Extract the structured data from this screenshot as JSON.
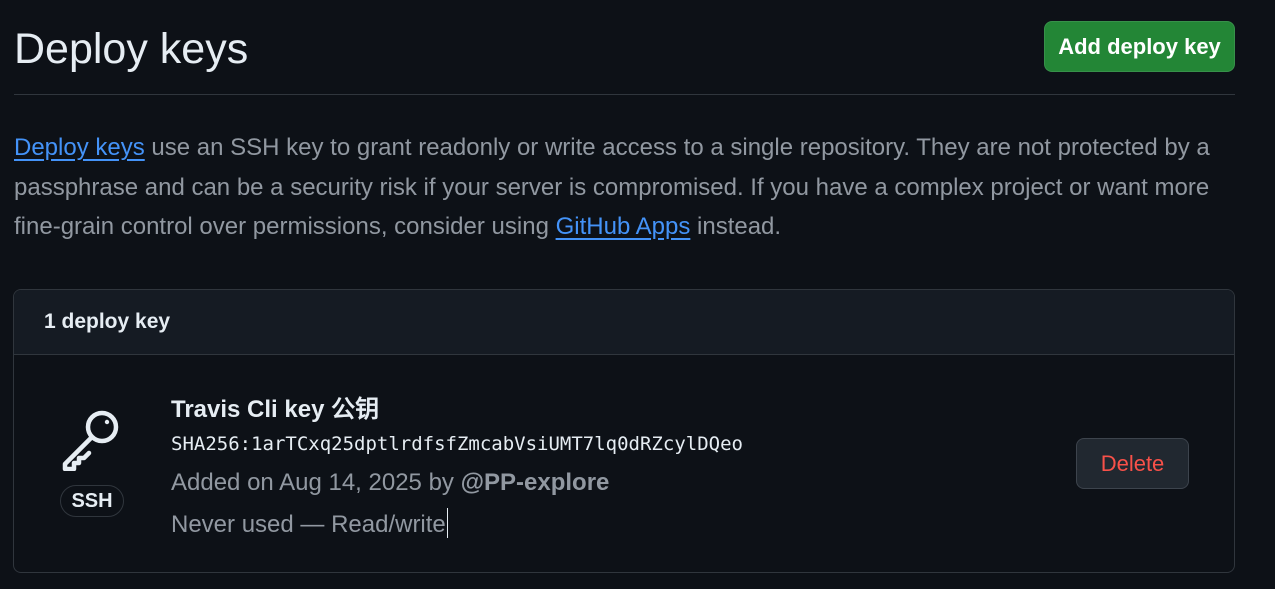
{
  "header": {
    "title": "Deploy keys",
    "add_button_label": "Add deploy key"
  },
  "description": {
    "link1_text": "Deploy keys",
    "text1": " use an SSH key to grant readonly or write access to a single repository. They are not protected by a passphrase and can be a security risk if your server is compromised. If you have a complex project or want more fine-grain control over permissions, consider using ",
    "link2_text": "GitHub Apps",
    "text2": " instead."
  },
  "keys_box": {
    "count_label": "1 deploy key",
    "keys": [
      {
        "icon": "key-icon",
        "type_label": "SSH",
        "title": "Travis Cli key 公钥",
        "fingerprint": "SHA256:1arTCxq25dptlrdfsfZmcabVsiUMT7lq0dRZcylDQeo",
        "added_prefix": "Added on Aug 14, 2025 by ",
        "added_by": "@PP-explore",
        "usage": "Never used — Read/write",
        "delete_label": "Delete"
      }
    ]
  },
  "colors": {
    "background": "#0d1117",
    "primary_button": "#238636",
    "link": "#4493f8",
    "danger": "#f85149",
    "muted_text": "#9198a1"
  }
}
